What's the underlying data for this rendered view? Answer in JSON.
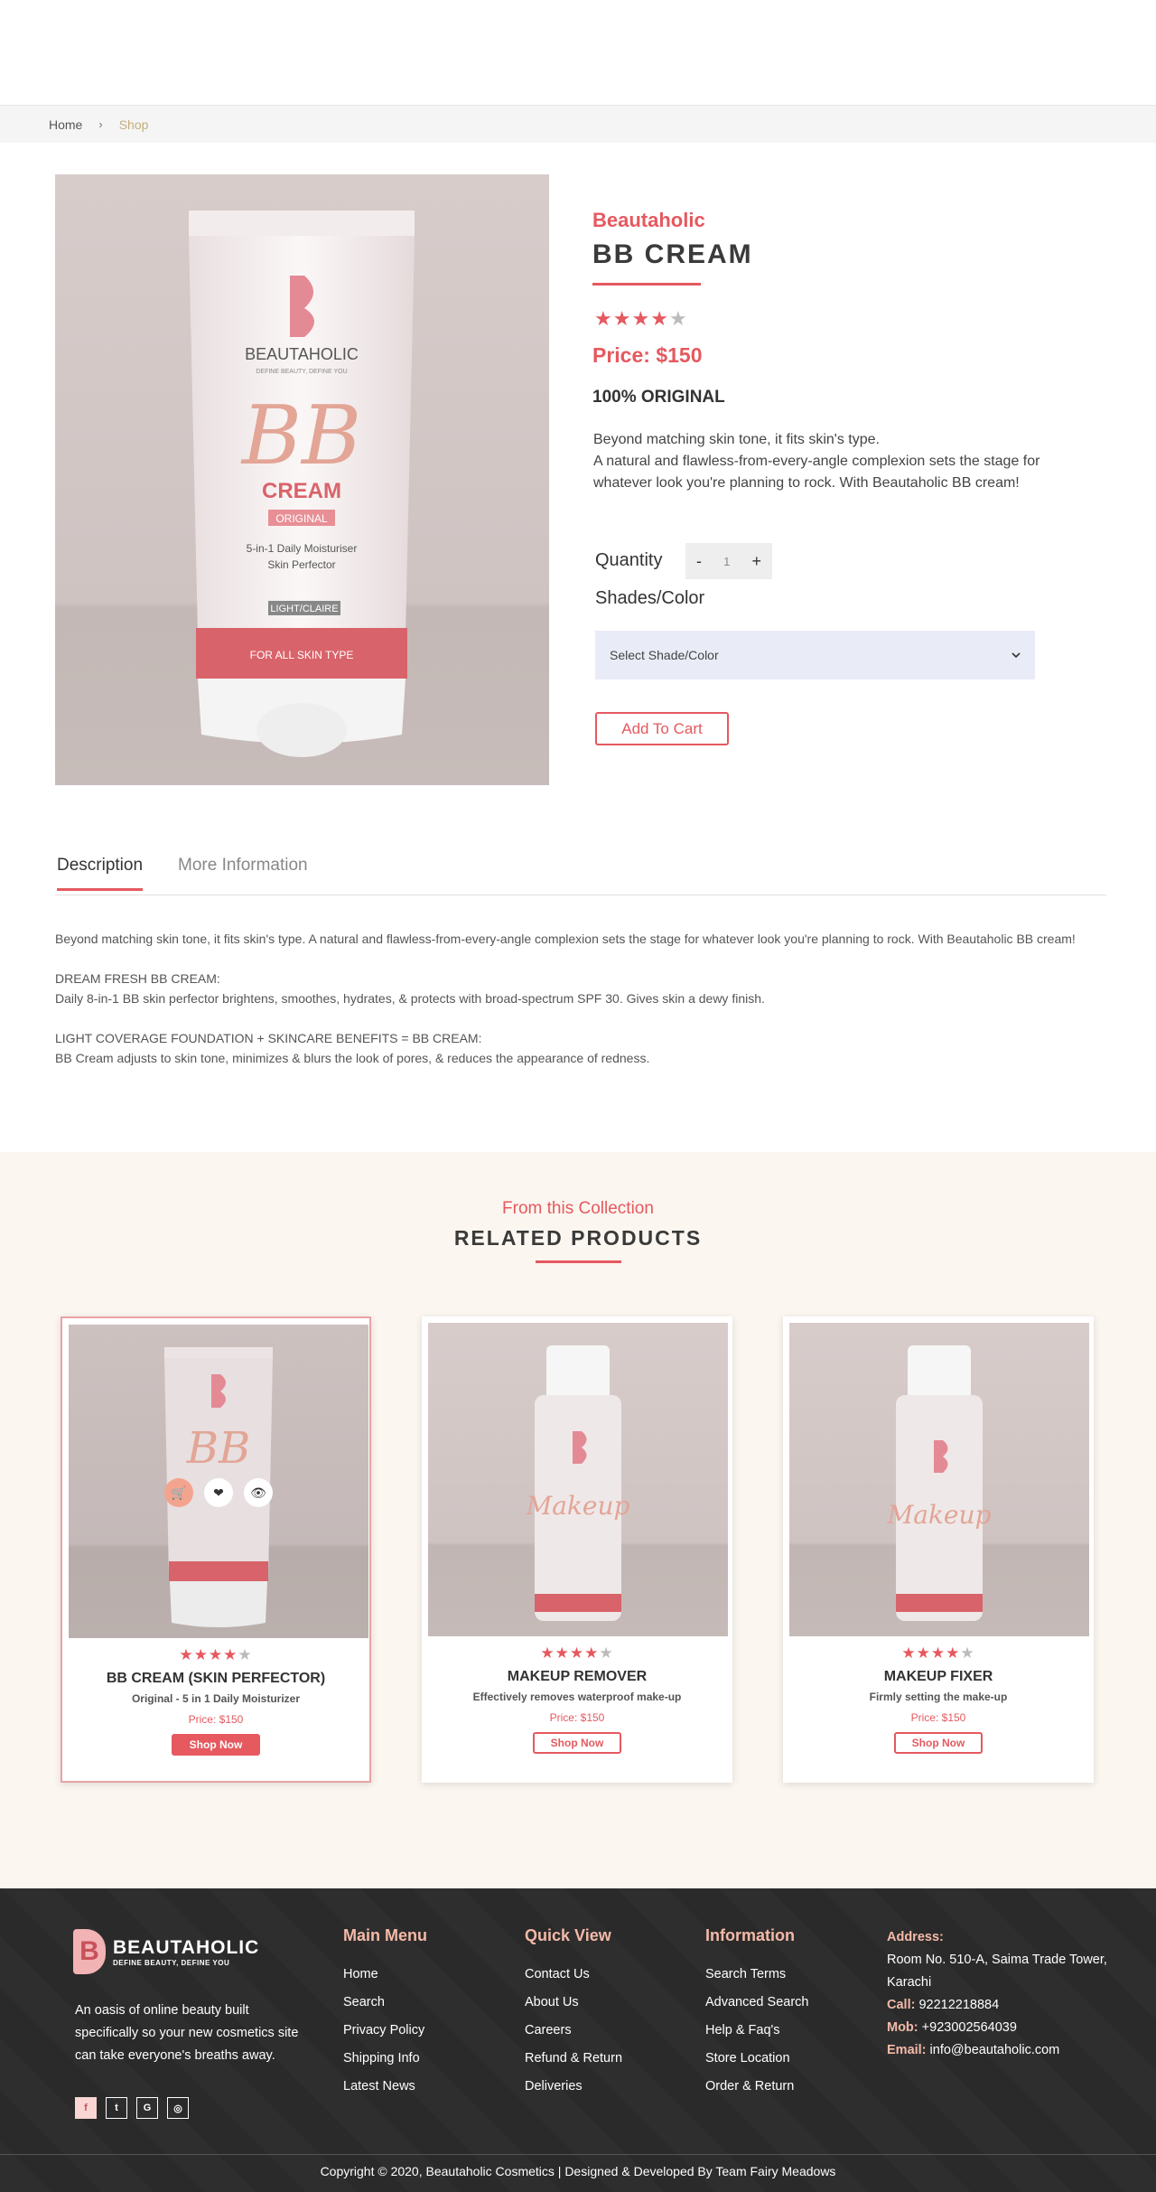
{
  "breadcrumb": {
    "home": "Home",
    "separator": "›",
    "current": "Shop"
  },
  "product": {
    "brand": "Beautaholic",
    "title": "BB CREAM",
    "rating": 4,
    "rating_max": 5,
    "price": "Price: $150",
    "original": "100% ORIGINAL",
    "short_desc_1": "Beyond matching skin tone, it fits skin's type.",
    "short_desc_2": "A natural and flawless-from-every-angle complexion sets the stage for whatever look you're planning to rock. With Beautaholic BB cream!",
    "quantity_label": "Quantity",
    "qty_minus": "-",
    "qty_value": "1",
    "qty_plus": "+",
    "shade_label": "Shades/Color",
    "shade_placeholder": "Select Shade/Color",
    "add_to_cart": "Add To Cart",
    "image": {
      "brand": "BEAUTAHOLIC",
      "tagline": "DEFINE BEAUTY, DEFINE YOU",
      "bb": "BB",
      "cream": "CREAM",
      "original": "ORIGINAL",
      "line1": "5-in-1 Daily Moisturiser",
      "line2": "Skin Perfector",
      "shade": "LIGHT/CLAIRE",
      "band": "FOR ALL SKIN TYPE"
    }
  },
  "tabs": {
    "description": "Description",
    "more_info": "More Information"
  },
  "description": {
    "p1": "Beyond matching skin tone, it fits skin's type. A natural and flawless-from-every-angle complexion sets the stage for whatever look you're planning to rock. With Beautaholic BB cream!",
    "h2": "DREAM FRESH BB CREAM:",
    "p2": "Daily 8-in-1 BB skin perfector brightens, smoothes, hydrates, & protects with broad-spectrum SPF 30. Gives skin a dewy finish.",
    "h3": "LIGHT COVERAGE FOUNDATION + SKINCARE BENEFITS = BB CREAM:",
    "p3": "BB Cream adjusts to skin tone, minimizes & blurs the look of pores, & reduces the appearance of redness."
  },
  "related": {
    "subtitle": "From this Collection",
    "title": "RELATED PRODUCTS",
    "cards": [
      {
        "name": "BB CREAM (SKIN PERFECTOR)",
        "sub": "Original - 5 in 1 Daily Moisturizer",
        "price": "Price: $150",
        "button": "Shop Now",
        "rating": 4
      },
      {
        "name": "MAKEUP REMOVER",
        "sub": "Effectively removes waterproof make-up",
        "price": "Price: $150",
        "button": "Shop Now",
        "rating": 4
      },
      {
        "name": "MAKEUP FIXER",
        "sub": "Firmly setting the make-up",
        "price": "Price: $150",
        "button": "Shop Now",
        "rating": 4
      }
    ]
  },
  "footer": {
    "logo": "BEAUTAHOLIC",
    "logo_tag": "DEFINE BEAUTY, DEFINE YOU",
    "about": "An oasis of online beauty built specifically so your new cosmetics site can take everyone's breaths away.",
    "social": [
      "f",
      "t",
      "G",
      "◎"
    ],
    "main_menu": {
      "title": "Main Menu",
      "items": [
        "Home",
        "Search",
        "Privacy Policy",
        "Shipping Info",
        "Latest News"
      ]
    },
    "quick_view": {
      "title": "Quick View",
      "items": [
        "Contact Us",
        "About Us",
        "Careers",
        "Refund & Return",
        "Deliveries"
      ]
    },
    "information": {
      "title": "Information",
      "items": [
        "Search Terms",
        "Advanced Search",
        "Help & Faq's",
        "Store Location",
        "Order & Return"
      ]
    },
    "address_label": "Address:",
    "address": "Room No. 510-A, Saima Trade Tower, Karachi",
    "call_label": "Call:",
    "call": "92212218884",
    "mob_label": "Mob:",
    "mob": "+923002564039",
    "email_label": "Email:",
    "email": "info@beautaholic.com",
    "copyright": "Copyright © 2020, Beautaholic Cosmetics | Designed & Developed By Team Fairy Meadows"
  },
  "colors": {
    "accent": "#e5595f",
    "gold": "#c4ad7c",
    "footer_bg": "#2b2b2b",
    "footer_heading": "#f4b9a8"
  }
}
